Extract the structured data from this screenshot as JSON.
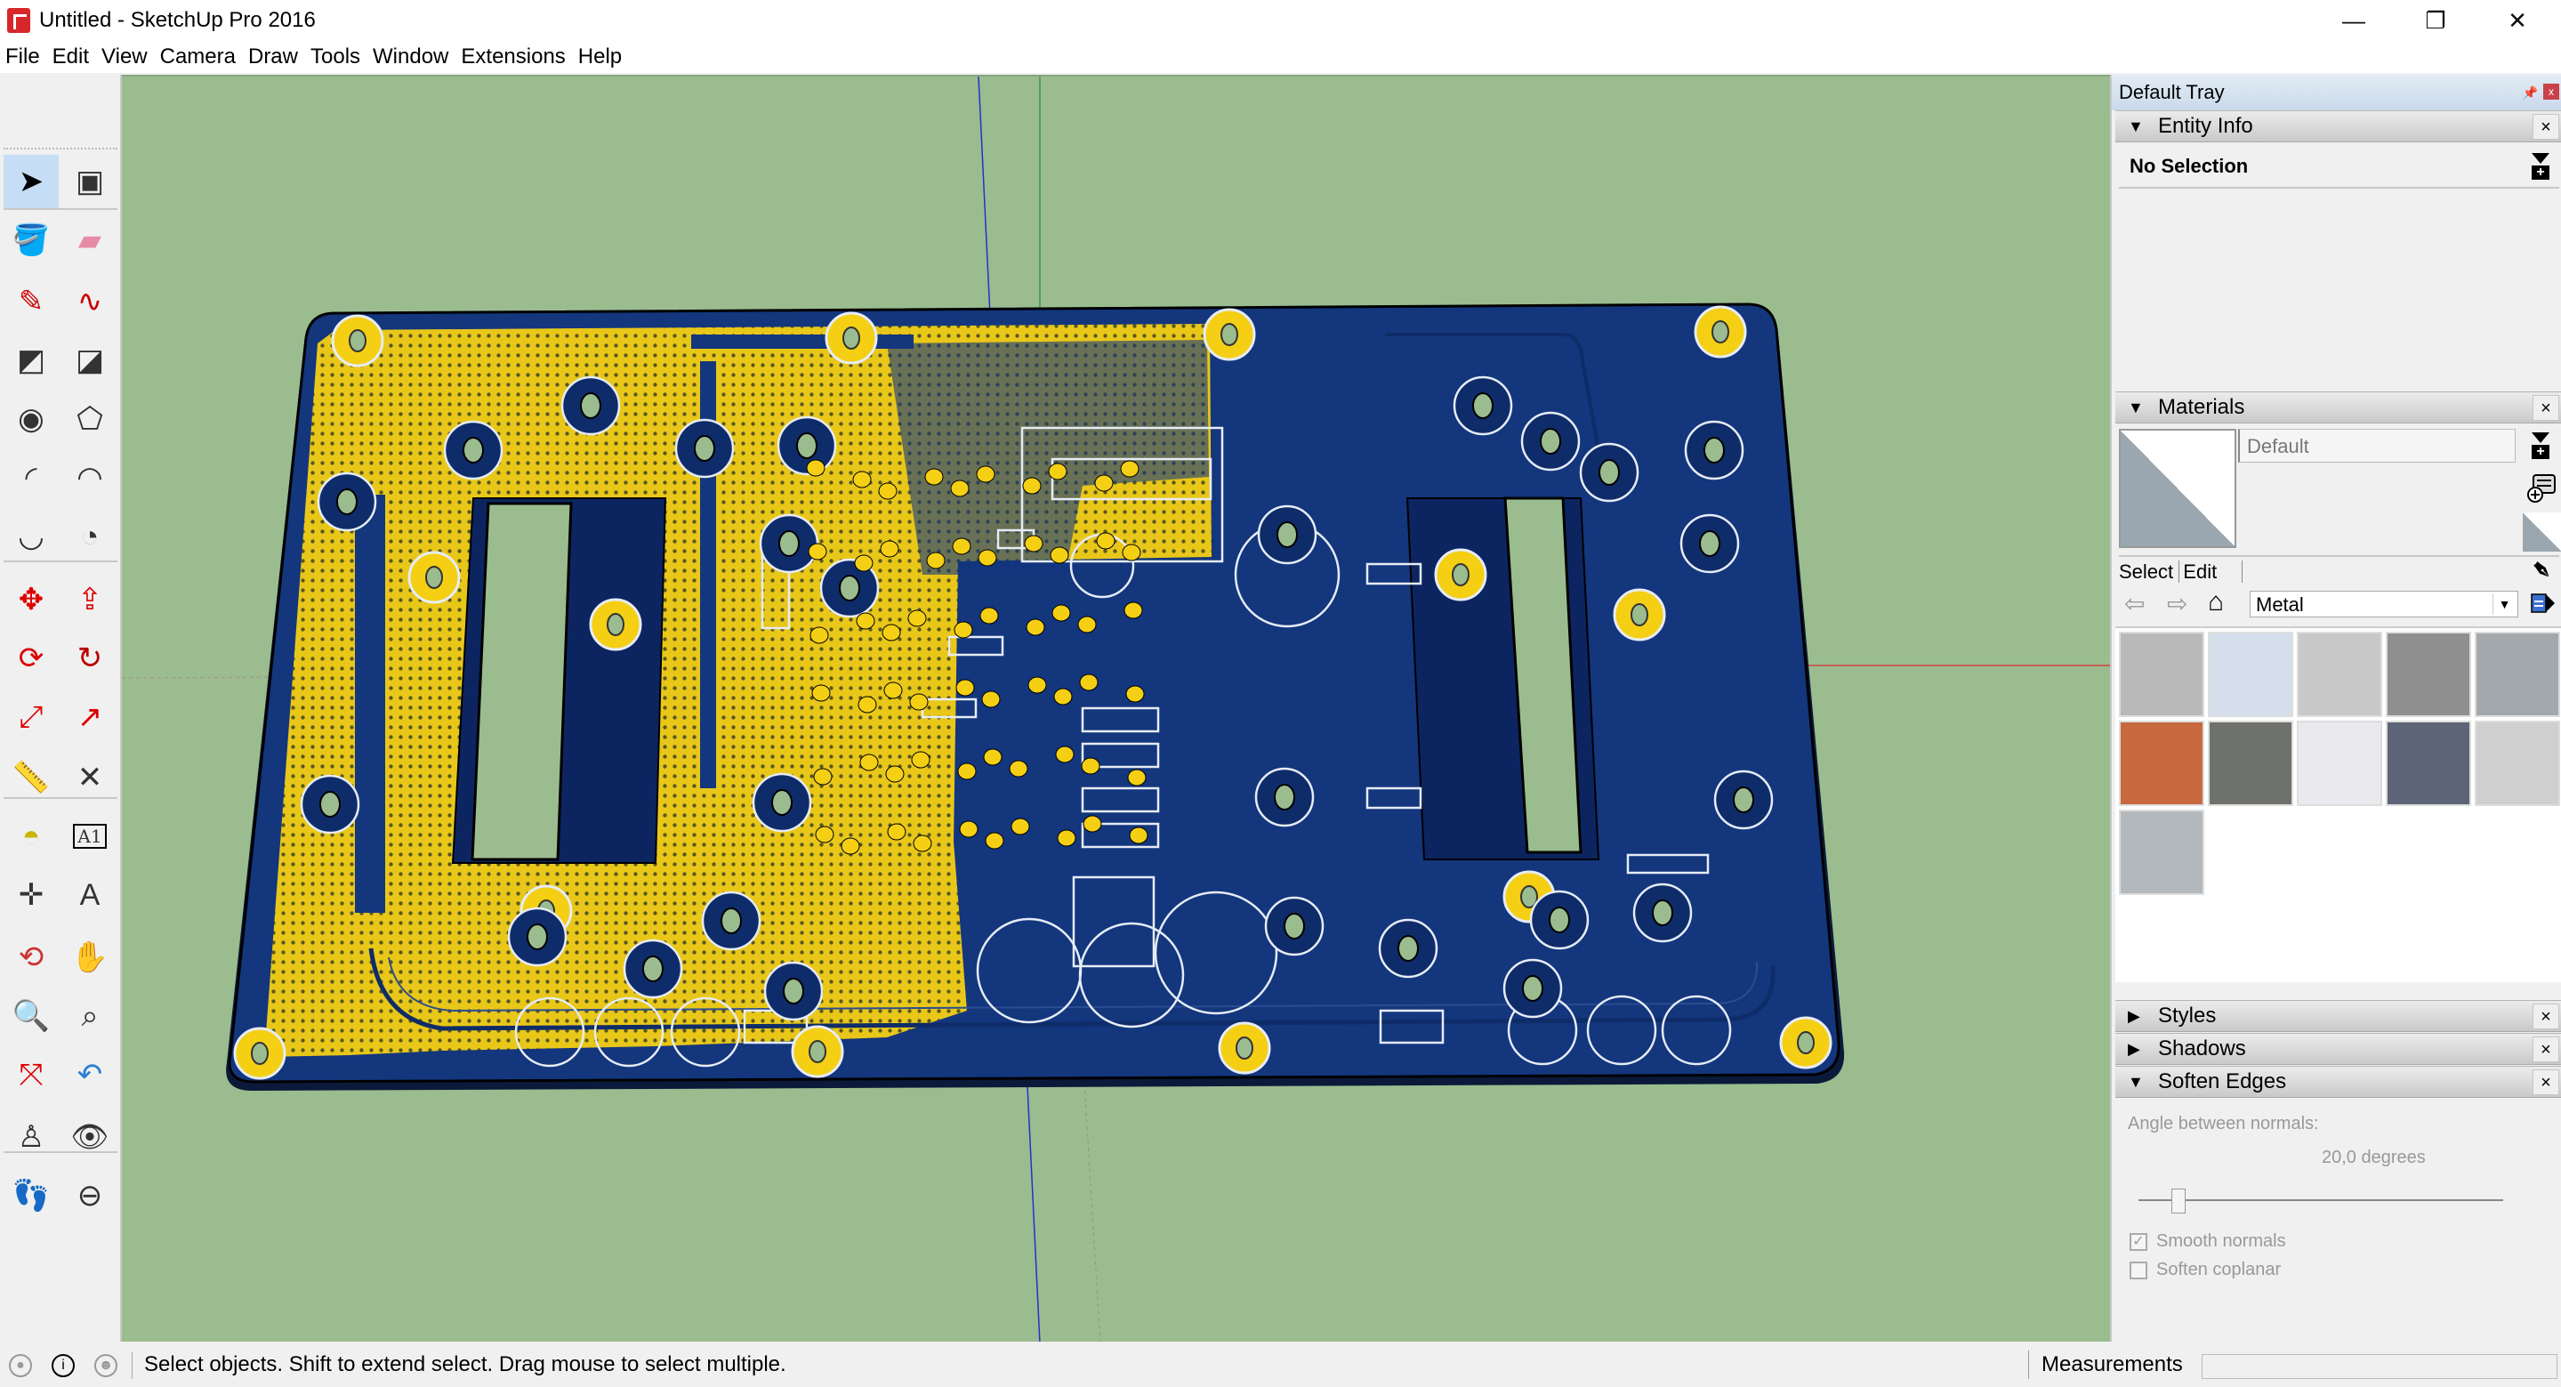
{
  "window": {
    "title": "Untitled - SketchUp Pro 2016",
    "minimize": "—",
    "restore": "❐",
    "close": "✕"
  },
  "menu": [
    "File",
    "Edit",
    "View",
    "Camera",
    "Draw",
    "Tools",
    "Window",
    "Extensions",
    "Help"
  ],
  "toolbar": {
    "tools": [
      {
        "name": "select-tool",
        "active": true
      },
      {
        "name": "make-component-tool"
      },
      {
        "name": "paint-bucket-tool"
      },
      {
        "name": "eraser-tool"
      },
      {
        "name": "line-tool"
      },
      {
        "name": "freehand-tool"
      },
      {
        "name": "rectangle-tool"
      },
      {
        "name": "rotated-rectangle-tool"
      },
      {
        "name": "circle-tool"
      },
      {
        "name": "polygon-tool"
      },
      {
        "name": "arc-tool"
      },
      {
        "name": "2point-arc-tool"
      },
      {
        "name": "3point-arc-tool"
      },
      {
        "name": "pie-tool"
      },
      {
        "name": "move-tool"
      },
      {
        "name": "push-pull-tool"
      },
      {
        "name": "rotate-tool"
      },
      {
        "name": "follow-me-tool"
      },
      {
        "name": "scale-tool"
      },
      {
        "name": "offset-tool"
      },
      {
        "name": "tape-measure-tool"
      },
      {
        "name": "dimension-tool"
      },
      {
        "name": "protractor-tool"
      },
      {
        "name": "text-tool",
        "label": "A1"
      },
      {
        "name": "axes-tool"
      },
      {
        "name": "3d-text-tool"
      },
      {
        "name": "orbit-tool"
      },
      {
        "name": "pan-tool"
      },
      {
        "name": "zoom-tool"
      },
      {
        "name": "zoom-window-tool"
      },
      {
        "name": "zoom-extents-tool"
      },
      {
        "name": "previous-view-tool"
      },
      {
        "name": "position-camera-tool"
      },
      {
        "name": "look-around-tool"
      },
      {
        "name": "walk-tool"
      },
      {
        "name": "section-plane-tool"
      }
    ]
  },
  "viewport": {
    "background": "#9bbc8f",
    "model": "PCB board",
    "colors": {
      "board": "#12357a",
      "copper": "#f4cf14",
      "silkscreen": "#e6ecf5",
      "hole": "#9bbc8f"
    }
  },
  "tray": {
    "title": "Default Tray",
    "pin": "ꟷ",
    "close": "x",
    "entity_info": {
      "label": "Entity Info",
      "expanded": "▼",
      "selection": "No Selection"
    },
    "materials": {
      "label": "Materials",
      "expanded": "▼",
      "name": "Default",
      "tabs": [
        "Select",
        "Edit"
      ],
      "library": "Metal",
      "swatches": [
        {
          "name": "metal-brushed",
          "color": "#b9b9b9"
        },
        {
          "name": "metal-light-blue",
          "color": "#d5dfeb"
        },
        {
          "name": "metal-corrugated",
          "color": "#c8c8c8"
        },
        {
          "name": "metal-embossed",
          "color": "#8f8f8f"
        },
        {
          "name": "metal-steel",
          "color": "#a3a8ac"
        },
        {
          "name": "metal-rusted",
          "color": "#c8683f"
        },
        {
          "name": "metal-dark",
          "color": "#6e716c"
        },
        {
          "name": "metal-white",
          "color": "#e9e9ee"
        },
        {
          "name": "metal-blue-perforated",
          "color": "#5d6478"
        },
        {
          "name": "metal-diamond-plate",
          "color": "#cfcfcf"
        },
        {
          "name": "metal-silver",
          "color": "#b3b8bd"
        }
      ]
    },
    "styles": {
      "label": "Styles",
      "expanded": "▶"
    },
    "shadows": {
      "label": "Shadows",
      "expanded": "▶"
    },
    "soften_edges": {
      "label": "Soften Edges",
      "expanded": "▼",
      "angle_label": "Angle between normals:",
      "angle_value": "20,0  degrees",
      "slider_fraction": 0.11,
      "smooth_normals": {
        "label": "Smooth normals",
        "checked": true
      },
      "soften_coplanar": {
        "label": "Soften coplanar",
        "checked": false
      }
    }
  },
  "status": {
    "text": "Select objects. Shift to extend select. Drag mouse to select multiple.",
    "measurements_label": "Measurements",
    "measurements_value": ""
  }
}
